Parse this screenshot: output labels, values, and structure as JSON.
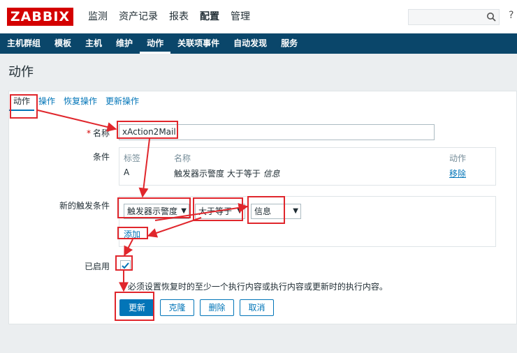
{
  "header": {
    "logo": "ZABBIX",
    "nav": [
      "监测",
      "资产记录",
      "报表",
      "配置",
      "管理"
    ],
    "active_nav": 3,
    "search_placeholder": "",
    "help_glyph": "?"
  },
  "subnav": {
    "items": [
      "主机群组",
      "模板",
      "主机",
      "维护",
      "动作",
      "关联项事件",
      "自动发现",
      "服务"
    ],
    "active": 4
  },
  "page_title": "动作",
  "tabs": [
    "动作",
    "操作",
    "恢复操作",
    "更新操作"
  ],
  "form": {
    "name_label": "名称",
    "required_mark": "*",
    "name_value": "xAction2Mail",
    "conditions_label": "条件",
    "conditions": {
      "headers": {
        "label": "标签",
        "name": "名称",
        "action": "动作"
      },
      "rows": [
        {
          "label": "A",
          "name": "触发器示警度 大于等于",
          "value": "信息",
          "action": "移除"
        }
      ]
    },
    "new_condition_label": "新的触发条件",
    "new_condition": {
      "type": "触发器示警度",
      "operator": "大于等于",
      "value": "信息",
      "add": "添加"
    },
    "enabled_label": "已启用",
    "enabled": true,
    "note": "* 必须设置恢复时的至少一个执行内容或执行内容或更新时的执行内容。",
    "buttons": {
      "update": "更新",
      "clone": "克隆",
      "delete": "删除",
      "cancel": "取消"
    }
  },
  "colors": {
    "brand": "#d40000",
    "subnav_bg": "#0a466a",
    "link": "#0275b8",
    "annotation": "#e0262c"
  }
}
